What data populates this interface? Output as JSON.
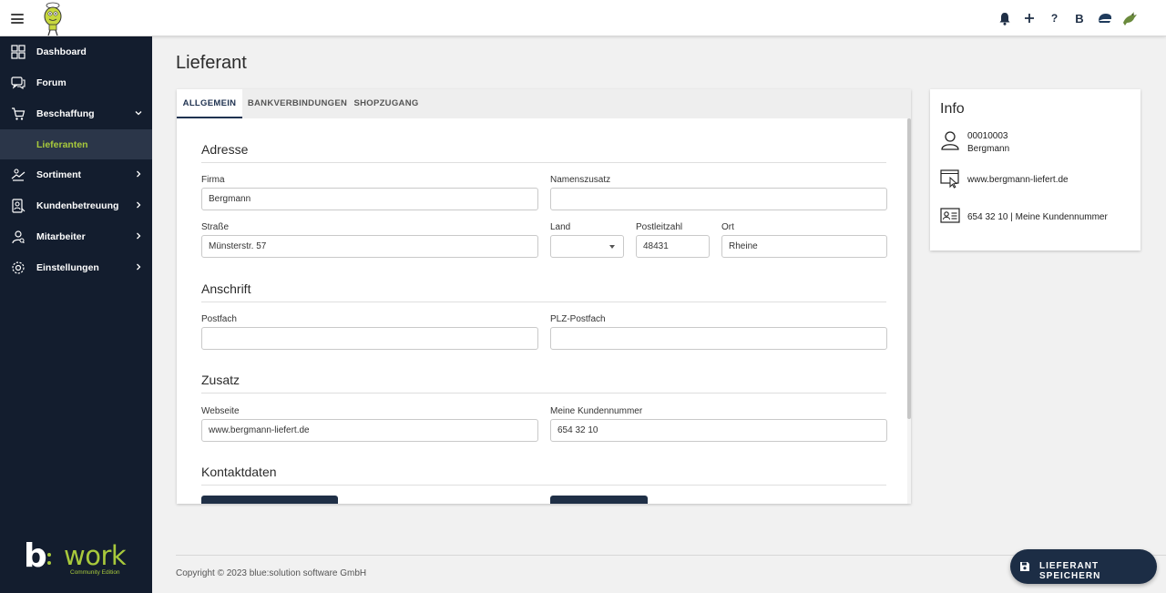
{
  "header": {
    "icons": [
      "menu-icon",
      "mascot-logo",
      "bell-icon",
      "plus-icon",
      "help-icon",
      "brand-b-icon",
      "cap-icon",
      "dragon-avatar"
    ],
    "help_label": "?",
    "brand_b_label": "B"
  },
  "sidebar": {
    "items": [
      {
        "label": "Dashboard",
        "icon": "dashboard-icon"
      },
      {
        "label": "Forum",
        "icon": "chat-icon"
      },
      {
        "label": "Beschaffung",
        "icon": "cart-icon",
        "expanded": true
      },
      {
        "label": "Lieferanten",
        "sub": true,
        "active": true
      },
      {
        "label": "Sortiment",
        "icon": "assortment-icon"
      },
      {
        "label": "Kundenbetreuung",
        "icon": "customer-icon"
      },
      {
        "label": "Mitarbeiter",
        "icon": "staff-icon"
      },
      {
        "label": "Einstellungen",
        "icon": "gear-icon"
      }
    ],
    "brand": {
      "b": "b",
      "work": "work",
      "edition": "Community Edition"
    }
  },
  "page": {
    "title": "Lieferant"
  },
  "tabs": [
    {
      "label": "ALLGEMEIN",
      "active": true
    },
    {
      "label": "BANKVERBINDUNGEN",
      "active": false
    },
    {
      "label": "SHOPZUGANG",
      "active": false
    }
  ],
  "form": {
    "adresse": {
      "title": "Adresse",
      "firma_label": "Firma",
      "firma_value": "Bergmann",
      "namenszusatz_label": "Namenszusatz",
      "namenszusatz_value": "",
      "strasse_label": "Straße",
      "strasse_value": "Münsterstr. 57",
      "land_label": "Land",
      "land_value": "",
      "plz_label": "Postleitzahl",
      "plz_value": "48431",
      "ort_label": "Ort",
      "ort_value": "Rheine"
    },
    "anschrift": {
      "title": "Anschrift",
      "postfach_label": "Postfach",
      "postfach_value": "",
      "plz_postfach_label": "PLZ-Postfach",
      "plz_postfach_value": ""
    },
    "zusatz": {
      "title": "Zusatz",
      "webseite_label": "Webseite",
      "webseite_value": "www.bergmann-liefert.de",
      "kundennummer_label": "Meine Kundennummer",
      "kundennummer_value": "654 32 10"
    },
    "kontaktdaten": {
      "title": "Kontaktdaten"
    }
  },
  "info": {
    "title": "Info",
    "number": "00010003",
    "name": "Bergmann",
    "website": "www.bergmann-liefert.de",
    "customer_number": "654 32 10 | Meine Kundennummer"
  },
  "footer": {
    "copyright": "Copyright © 2023 blue:solution software GmbH",
    "save_label": "LIEFERANT SPEICHERN"
  },
  "colors": {
    "accent": "#a8c93c",
    "sidebar": "#131d2e",
    "primary": "#1c2d45"
  }
}
